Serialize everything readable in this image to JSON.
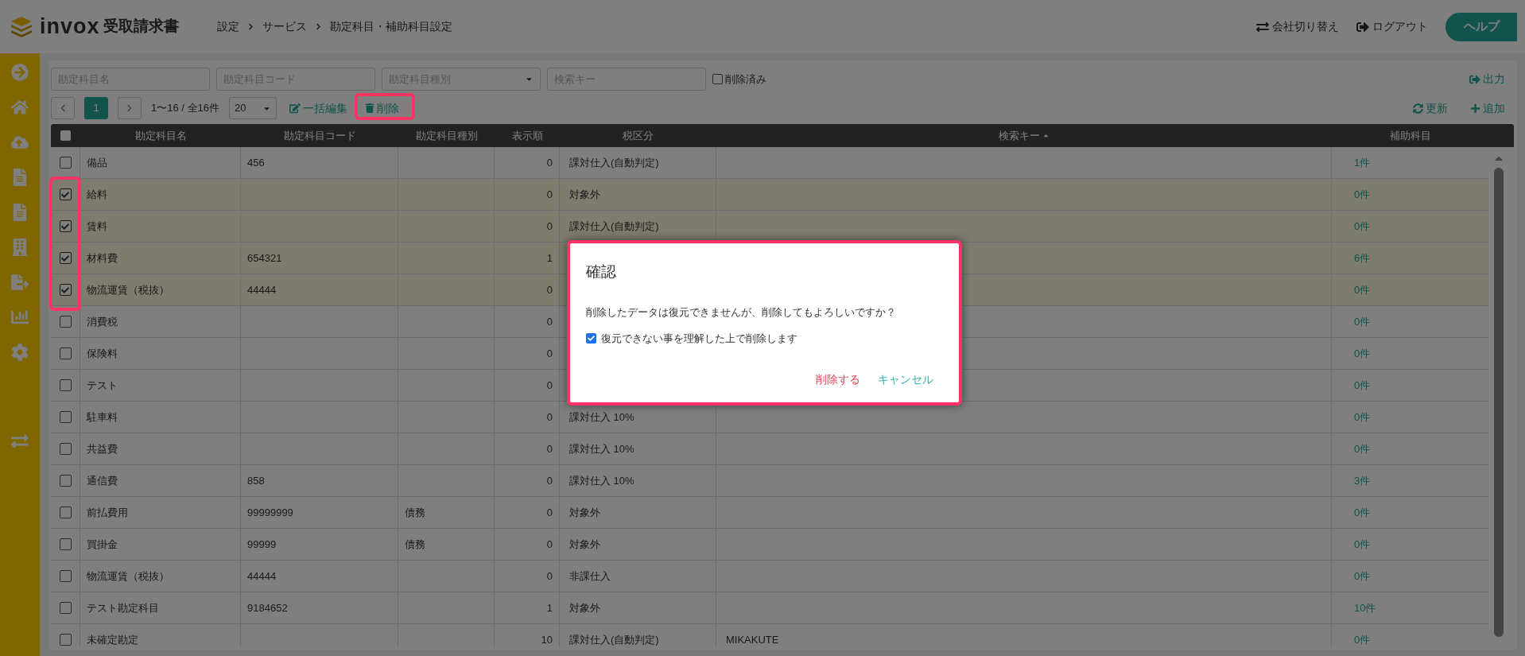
{
  "header": {
    "logo": "invox",
    "product": "受取請求書",
    "breadcrumb": [
      "設定",
      "サービス",
      "勘定科目・補助科目設定"
    ],
    "actions": [
      {
        "kind": "switch",
        "label": "会社切り替え"
      },
      {
        "kind": "logout",
        "label": "ログアウト"
      }
    ],
    "help": "ヘルプ"
  },
  "filters": {
    "fields": [
      {
        "kind": "text",
        "placeholder": "勘定科目名"
      },
      {
        "kind": "text",
        "placeholder": "勘定科目コード"
      },
      {
        "kind": "select",
        "placeholder": "勘定科目種別"
      },
      {
        "kind": "text",
        "placeholder": "検索キー"
      }
    ],
    "deleted": {
      "label": "削除済み",
      "checked": false
    },
    "export": "出力"
  },
  "toolbar": {
    "pages": [
      {
        "label": "1",
        "selected": true
      }
    ],
    "range": "1〜16 / 全16件",
    "page_size": "20",
    "bulk_edit": "一括編集",
    "delete": "削除",
    "refresh": "更新",
    "add": "追加"
  },
  "table": {
    "select_all": {
      "checked": false
    },
    "columns": [
      {
        "label": "勘定科目名"
      },
      {
        "label": "勘定科目コード"
      },
      {
        "label": "勘定科目種別"
      },
      {
        "label": "表示順"
      },
      {
        "label": "税区分"
      },
      {
        "label": "検索キー",
        "sorted": true
      },
      {
        "label": "補助科目"
      }
    ],
    "rows": [
      {
        "checked": false,
        "name": "備品",
        "code": "456",
        "order": "0",
        "tax": "課対仕入(自動判定)",
        "sub": "1件"
      },
      {
        "checked": true,
        "name": "給料",
        "order": "0",
        "tax": "対象外",
        "sub": "0件"
      },
      {
        "checked": true,
        "name": "賃料",
        "order": "0",
        "tax": "課対仕入(自動判定)",
        "sub": "0件"
      },
      {
        "checked": true,
        "name": "材料費",
        "code": "654321",
        "order": "1",
        "sub": "6件"
      },
      {
        "checked": true,
        "name": "物流運賃（税抜）",
        "code": "44444",
        "order": "0",
        "sub": "0件"
      },
      {
        "checked": false,
        "name": "消費税",
        "order": "0",
        "sub": "0件"
      },
      {
        "checked": false,
        "name": "保険料",
        "order": "0",
        "sub": "0件"
      },
      {
        "checked": false,
        "name": "テスト",
        "order": "0",
        "sub": "0件"
      },
      {
        "checked": false,
        "name": "駐車料",
        "order": "0",
        "tax": "課対仕入 10%",
        "sub": "0件"
      },
      {
        "checked": false,
        "name": "共益費",
        "order": "0",
        "tax": "課対仕入 10%",
        "sub": "0件"
      },
      {
        "checked": false,
        "name": "通信費",
        "code": "858",
        "order": "0",
        "tax": "課対仕入 10%",
        "sub": "3件"
      },
      {
        "checked": false,
        "name": "前払費用",
        "code": "99999999",
        "type": "債務",
        "order": "0",
        "tax": "対象外",
        "sub": "0件"
      },
      {
        "checked": false,
        "name": "買掛金",
        "code": "99999",
        "type": "債務",
        "order": "0",
        "tax": "対象外",
        "sub": "0件"
      },
      {
        "checked": false,
        "name": "物流運賃（税抜）",
        "code": "44444",
        "order": "0",
        "tax": "非課仕入",
        "sub": "0件"
      },
      {
        "checked": false,
        "name": "テスト勘定科目",
        "code": "9184652",
        "order": "1",
        "tax": "対象外",
        "sub": "10件"
      },
      {
        "checked": false,
        "name": "未確定勘定",
        "order": "10",
        "tax": "課対仕入(自動判定)",
        "search_key": "MIKAKUTE",
        "sub": "0件"
      }
    ]
  },
  "dialog": {
    "title": "確認",
    "message": "削除したデータは復元できませんが、削除してもよろしいですか？",
    "confirm": {
      "label": "復元できない事を理解した上で削除します",
      "checked": true
    },
    "buttons": [
      {
        "kind": "danger",
        "label": "削除する"
      },
      {
        "kind": "cancel",
        "label": "キャンセル"
      }
    ]
  }
}
